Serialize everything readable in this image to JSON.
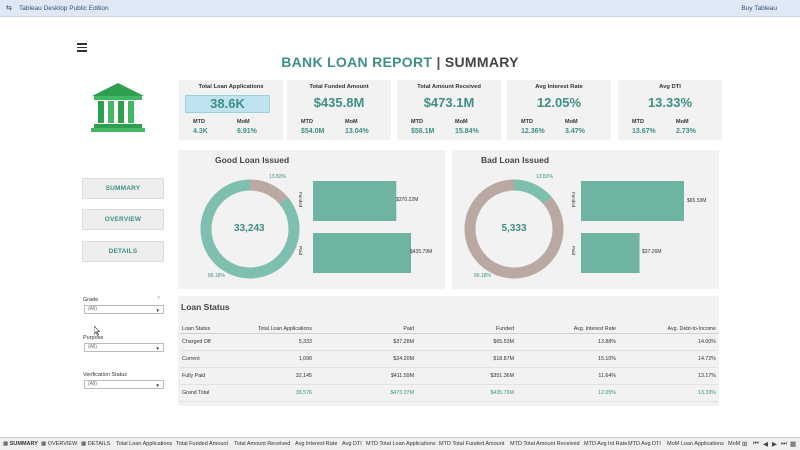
{
  "app": {
    "icon_glyph": "⇆",
    "title": "Tableau Desktop Public Edition",
    "buy_label": "Buy Tableau"
  },
  "report": {
    "title_main": "BANK LOAN REPORT",
    "title_sep": " | ",
    "title_sub": "SUMMARY"
  },
  "colors": {
    "accent": "#3f8f86",
    "donut_main": "#7fbfaf",
    "donut_alt": "#b9a9a2",
    "bar": "#6fb3a3",
    "panel_bg": "#f2f2f2",
    "highlight": "#bfe3ef"
  },
  "kpis": [
    {
      "title": "Total Loan Applications",
      "value": "38.6K",
      "mtd_label": "MTD",
      "mom_label": "MoM",
      "mtd": "4.3K",
      "mom": "6.91%",
      "highlighted": true
    },
    {
      "title": "Total Funded Amount",
      "value": "$435.8M",
      "mtd_label": "MTD",
      "mom_label": "MoM",
      "mtd": "$54.0M",
      "mom": "13.04%"
    },
    {
      "title": "Total Amount Received",
      "value": "$473.1M",
      "mtd_label": "MTD",
      "mom_label": "MoM",
      "mtd": "$58.1M",
      "mom": "15.84%"
    },
    {
      "title": "Avg Interest Rate",
      "value": "12.05%",
      "mtd_label": "MTD",
      "mom_label": "MoM",
      "mtd": "12.36%",
      "mom": "3.47%"
    },
    {
      "title": "Avg DTI",
      "value": "13.33%",
      "mtd_label": "MTD",
      "mom_label": "MoM",
      "mtd": "13.67%",
      "mom": "2.73%"
    }
  ],
  "nav": {
    "summary": "SUMMARY",
    "overview": "OVERVIEW",
    "details": "DETAILS"
  },
  "good_loan": {
    "title": "Good Loan Issued",
    "center_value": "33,243",
    "pct_major": "86.18%",
    "pct_minor": "13.82%",
    "bar_labels": [
      "Funded",
      "Paid"
    ],
    "bar_values_label": [
      "$370.22M",
      "$435.79M"
    ]
  },
  "bad_loan": {
    "title": "Bad Loan Issued",
    "center_value": "5,333",
    "pct_major": "86.18%",
    "pct_minor": "13.82%",
    "bar_labels": [
      "Funded",
      "Paid"
    ],
    "bar_values_label": [
      "$65.53M",
      "$37.26M"
    ]
  },
  "chart_data": [
    {
      "type": "pie",
      "title": "Good Loan Issued",
      "categories": [
        "Good",
        "Bad"
      ],
      "values": [
        86.18,
        13.82
      ]
    },
    {
      "type": "bar",
      "title": "Good Loan Issued",
      "categories": [
        "Funded",
        "Paid"
      ],
      "values": [
        370.22,
        435.79
      ]
    },
    {
      "type": "pie",
      "title": "Bad Loan Issued",
      "categories": [
        "Bad",
        "Good"
      ],
      "values": [
        13.82,
        86.18
      ]
    },
    {
      "type": "bar",
      "title": "Bad Loan Issued",
      "categories": [
        "Funded",
        "Paid"
      ],
      "values": [
        65.53,
        37.26
      ]
    }
  ],
  "filters": [
    {
      "label": "Grade",
      "value": "(All)"
    },
    {
      "label": "Purpose",
      "value": "(All)"
    },
    {
      "label": "Verification Status",
      "value": "(All)"
    }
  ],
  "loan_status": {
    "title": "Loan Status",
    "columns": [
      "Loan Status",
      "Total Loan Applications",
      "Paid",
      "Funded",
      "Avg. Interest Rate",
      "Avg. Debt-to-Income"
    ],
    "rows": [
      [
        "Charged Off",
        "5,333",
        "$37.28M",
        "$65.53M",
        "13.88%",
        "14.00%"
      ],
      [
        "Current",
        "1,098",
        "$24.20M",
        "$18.87M",
        "15.10%",
        "14.72%"
      ],
      [
        "Fully Paid",
        "32,145",
        "$411.59M",
        "$351.36M",
        "11.64%",
        "13.17%"
      ]
    ],
    "grand_total": [
      "Grand Total",
      "38,576",
      "$473.07M",
      "$435.76M",
      "12.05%",
      "13.33%"
    ]
  },
  "tabs": [
    {
      "label": "SUMMARY",
      "active": true
    },
    {
      "label": "OVERVIEW"
    },
    {
      "label": "DETAILS"
    },
    {
      "label": "Total Loan Applications"
    },
    {
      "label": "Total Funded Amount"
    },
    {
      "label": "Total Amount Received"
    },
    {
      "label": "Avg Interest Rate"
    },
    {
      "label": "Avg DTI"
    },
    {
      "label": "MTD Total Loan Applications"
    },
    {
      "label": "MTD Total Funded Amount"
    },
    {
      "label": "MTD Total Amount Received"
    },
    {
      "label": "MTD Avg Int Rate"
    },
    {
      "label": "MTD Avg DTI"
    },
    {
      "label": "MoM Loan Applications"
    },
    {
      "label": "MoM"
    }
  ]
}
